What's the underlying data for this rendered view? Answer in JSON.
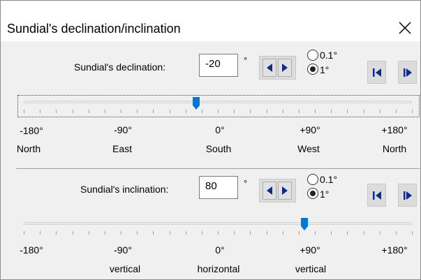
{
  "window": {
    "title": "Sundial's declination/inclination",
    "close_icon": "close-icon"
  },
  "declination": {
    "label": "Sundial's declination:",
    "value": "-20",
    "unit": "°",
    "step_options": [
      "0.1°",
      "1°"
    ],
    "selected_step": "1°",
    "slider_value": -20,
    "range": [
      -180,
      180
    ],
    "scale": [
      "-180°",
      "-90°",
      "0°",
      "+90°",
      "+180°"
    ],
    "directions": [
      "North",
      "East",
      "South",
      "West",
      "North"
    ]
  },
  "inclination": {
    "label": "Sundial's inclination:",
    "value": "80",
    "unit": "°",
    "step_options": [
      "0.1°",
      "1°"
    ],
    "selected_step": "1°",
    "slider_value": 80,
    "range": [
      -180,
      180
    ],
    "scale": [
      "-180°",
      "-90°",
      "0°",
      "+90°",
      "+180°"
    ],
    "descriptors": [
      "vertical",
      "horizontal",
      "vertical"
    ]
  },
  "colors": {
    "thumb": "#0078d7",
    "arrow": "#0f2a8a"
  }
}
